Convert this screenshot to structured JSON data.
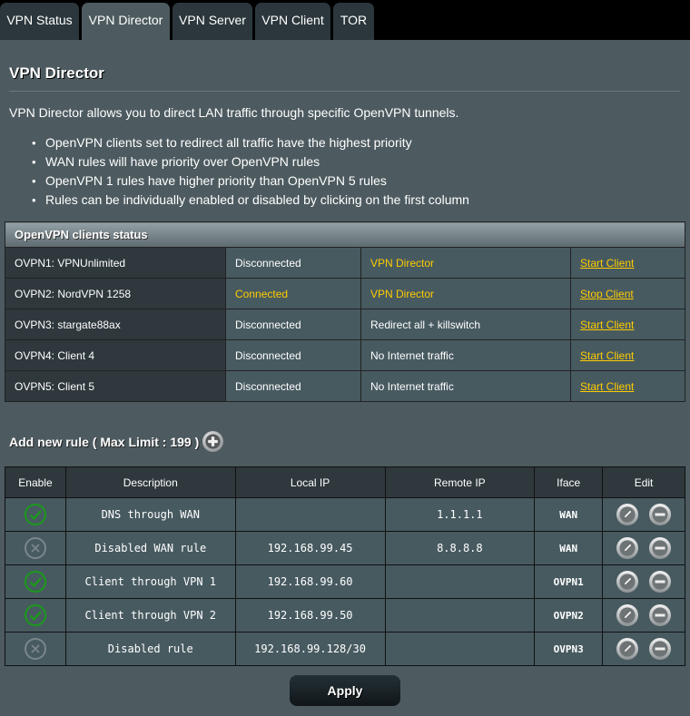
{
  "tabs": [
    {
      "label": "VPN Status",
      "active": false
    },
    {
      "label": "VPN Director",
      "active": true
    },
    {
      "label": "VPN Server",
      "active": false
    },
    {
      "label": "VPN Client",
      "active": false
    },
    {
      "label": "TOR",
      "active": false
    }
  ],
  "page": {
    "title": "VPN Director",
    "intro": "VPN Director allows you to direct LAN traffic through specific OpenVPN tunnels.",
    "bullets": [
      "OpenVPN clients set to redirect all traffic have the highest priority",
      "WAN rules will have priority over OpenVPN rules",
      "OpenVPN 1 rules have higher priority than OpenVPN 5 rules",
      "Rules can be individually enabled or disabled by clicking on the first column"
    ]
  },
  "clients_status": {
    "title": "OpenVPN clients status",
    "rows": [
      {
        "name": "OVPN1: VPNUnlimited",
        "state": "Disconnected",
        "connected": false,
        "mode": "VPN Director",
        "mode_highlight": true,
        "action": "Start Client"
      },
      {
        "name": "OVPN2: NordVPN 1258",
        "state": "Connected",
        "connected": true,
        "mode": "VPN Director",
        "mode_highlight": true,
        "action": "Stop Client"
      },
      {
        "name": "OVPN3: stargate88ax",
        "state": "Disconnected",
        "connected": false,
        "mode": "Redirect all + killswitch",
        "mode_highlight": false,
        "action": "Start Client"
      },
      {
        "name": "OVPN4: Client 4",
        "state": "Disconnected",
        "connected": false,
        "mode": "No Internet traffic",
        "mode_highlight": false,
        "action": "Start Client"
      },
      {
        "name": "OVPN5: Client 5",
        "state": "Disconnected",
        "connected": false,
        "mode": "No Internet traffic",
        "mode_highlight": false,
        "action": "Start Client"
      }
    ]
  },
  "add_rule": {
    "label": "Add new rule ( Max Limit : 199 )",
    "icon": "plus-circle-icon"
  },
  "rules": {
    "headers": [
      "Enable",
      "Description",
      "Local IP",
      "Remote IP",
      "Iface",
      "Edit"
    ],
    "rows": [
      {
        "enabled": true,
        "description": "DNS through WAN",
        "local_ip": "",
        "remote_ip": "1.1.1.1",
        "iface": "WAN"
      },
      {
        "enabled": false,
        "description": "Disabled WAN rule",
        "local_ip": "192.168.99.45",
        "remote_ip": "8.8.8.8",
        "iface": "WAN"
      },
      {
        "enabled": true,
        "description": "Client through VPN 1",
        "local_ip": "192.168.99.60",
        "remote_ip": "",
        "iface": "OVPN1"
      },
      {
        "enabled": true,
        "description": "Client through VPN 2",
        "local_ip": "192.168.99.50",
        "remote_ip": "",
        "iface": "OVPN2"
      },
      {
        "enabled": false,
        "description": "Disabled rule",
        "local_ip": "192.168.99.128/30",
        "remote_ip": "",
        "iface": "OVPN3"
      }
    ]
  },
  "apply_label": "Apply",
  "colors": {
    "accent_yellow": "#ffcc00",
    "enabled_green": "#1a9a1a",
    "disabled_gray": "#7a878b"
  }
}
